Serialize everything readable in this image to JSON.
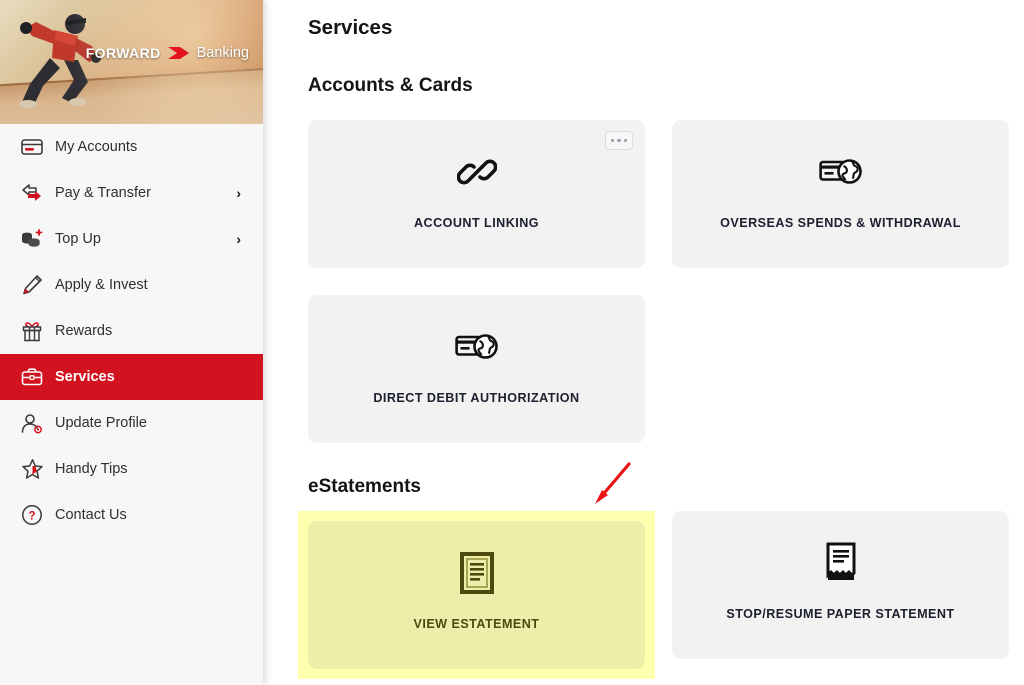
{
  "brand": {
    "logo_primary": "FORWARD",
    "logo_secondary": "Banking",
    "accent_red": "#d31220",
    "hero_icon": "runner-hero-image"
  },
  "sidebar": {
    "items": [
      {
        "label": "My Accounts",
        "icon": "credit-card-icon",
        "active": false,
        "chevron": ""
      },
      {
        "label": "Pay & Transfer",
        "icon": "transfer-arrow-icon",
        "active": false,
        "chevron": "›"
      },
      {
        "label": "Top Up",
        "icon": "coins-plus-icon",
        "active": false,
        "chevron": "›"
      },
      {
        "label": "Apply & Invest",
        "icon": "pen-icon",
        "active": false,
        "chevron": ""
      },
      {
        "label": "Rewards",
        "icon": "gift-icon",
        "active": false,
        "chevron": ""
      },
      {
        "label": "Services",
        "icon": "briefcase-icon",
        "active": true,
        "chevron": ""
      },
      {
        "label": "Update Profile",
        "icon": "user-edit-icon",
        "active": false,
        "chevron": ""
      },
      {
        "label": "Handy Tips",
        "icon": "star-icon",
        "active": false,
        "chevron": ""
      },
      {
        "label": "Contact Us",
        "icon": "question-circle-icon",
        "active": false,
        "chevron": ""
      }
    ]
  },
  "main": {
    "page_title": "Services",
    "sections": [
      {
        "title": "Accounts & Cards",
        "cards": [
          {
            "label": "ACCOUNT LINKING",
            "icon": "chain-link-icon",
            "has_menu": true,
            "highlighted": false
          },
          {
            "label": "OVERSEAS SPENDS & WITHDRAWAL",
            "icon": "card-globe-icon",
            "has_menu": false,
            "highlighted": false
          },
          {
            "label": "DIRECT DEBIT AUTHORIZATION",
            "icon": "card-globe-icon",
            "has_menu": false,
            "highlighted": false
          }
        ]
      },
      {
        "title": "eStatements",
        "cards": [
          {
            "label": "VIEW ESTATEMENT",
            "icon": "document-lines-icon",
            "has_menu": false,
            "highlighted": true
          },
          {
            "label": "STOP/RESUME PAPER STATEMENT",
            "icon": "receipt-torn-icon",
            "has_menu": false,
            "highlighted": false
          }
        ]
      }
    ]
  },
  "annotation": {
    "arrow_color": "#e81313",
    "arrow_name": "red-pointer-arrow"
  }
}
